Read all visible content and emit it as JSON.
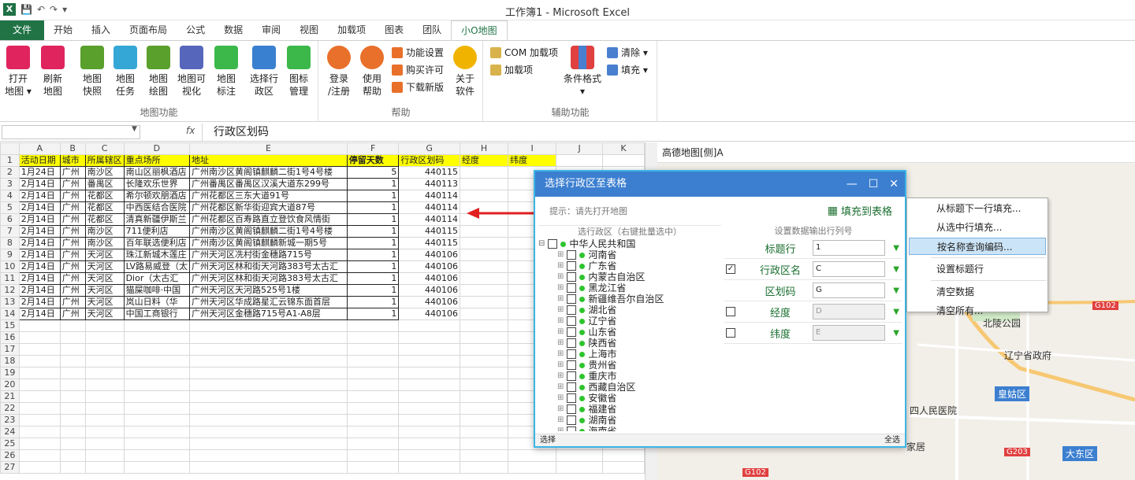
{
  "window": {
    "title": "工作簿1 - Microsoft Excel",
    "logo": "X"
  },
  "tabs": [
    "文件",
    "开始",
    "插入",
    "页面布局",
    "公式",
    "数据",
    "审阅",
    "视图",
    "加载项",
    "图表",
    "团队",
    "小O地图"
  ],
  "ribbon": {
    "map_group": {
      "label": "地图功能",
      "buttons": [
        {
          "label1": "打开",
          "label2": "地图 ▾",
          "color": "#e0245e"
        },
        {
          "label1": "刷新",
          "label2": "地图",
          "color": "#e0245e"
        },
        {
          "label1": "地图",
          "label2": "快照",
          "color": "#5aa02c"
        },
        {
          "label1": "地图",
          "label2": "任务",
          "color": "#35a7d6"
        },
        {
          "label1": "地图",
          "label2": "绘图",
          "color": "#5aa02c"
        },
        {
          "label1": "地图可",
          "label2": "视化",
          "color": "#5566bb"
        },
        {
          "label1": "地图",
          "label2": "标注",
          "color": "#3cb84a"
        },
        {
          "label1": "选择行",
          "label2": "政区",
          "color": "#3a80d0"
        },
        {
          "label1": "图标",
          "label2": "管理",
          "color": "#3cb84a"
        }
      ]
    },
    "help_group": {
      "label": "帮助",
      "buttons": [
        {
          "label1": "登录",
          "label2": "/注册",
          "color": "#e8702a"
        },
        {
          "label1": "使用",
          "label2": "帮助",
          "color": "#e8702a"
        },
        {
          "label1": "关于",
          "label2": "软件",
          "color": "#f0b400"
        }
      ],
      "small": [
        "功能设置",
        "购买许可",
        "下载新版"
      ]
    },
    "aux_group": {
      "label": "辅助功能",
      "small": [
        "COM 加载项",
        "加载项"
      ],
      "cond_label": "条件格式",
      "cond_caret": "▾",
      "right_small": [
        "清除 ▾",
        "填充 ▾"
      ]
    }
  },
  "formula_bar": {
    "name_box": "",
    "fx": "fx",
    "content": "行政区划码"
  },
  "sheet": {
    "columns": [
      "A",
      "B",
      "C",
      "D",
      "E",
      "F",
      "G",
      "H",
      "I",
      "J",
      "K"
    ],
    "header": [
      "活动日期",
      "城市",
      "所属辖区",
      "重点场所",
      "地址",
      "停留天数",
      "行政区划码",
      "经度",
      "纬度",
      "",
      ""
    ],
    "rows": [
      [
        "1月24日",
        "广州",
        "南沙区",
        "南山区丽枫酒店",
        "广州南沙区黄阁镇麒麟二街1号4号楼",
        "5",
        "440115"
      ],
      [
        "2月14日",
        "广州",
        "番禺区",
        "长隆欢乐世界",
        "广州番禺区番禺区汉溪大道东299号",
        "1",
        "440113"
      ],
      [
        "2月14日",
        "广州",
        "花都区",
        "希尔顿欢朋酒店",
        "广州花都区三东大道91号",
        "1",
        "440114"
      ],
      [
        "2月14日",
        "广州",
        "花都区",
        "中西医结合医院",
        "广州花都区新华街迎宾大道87号",
        "1",
        "440114"
      ],
      [
        "2月14日",
        "广州",
        "花都区",
        "清真新疆伊斯兰",
        "广州花都区百寿路直立登饮食风情街",
        "1",
        "440114"
      ],
      [
        "2月14日",
        "广州",
        "南沙区",
        "711便利店",
        "广州南沙区黄阁镇麒麟二街1号4号楼",
        "1",
        "440115"
      ],
      [
        "2月14日",
        "广州",
        "南沙区",
        "百年联选便利店",
        "广州南沙区黄阁镇麒麟新城一期5号",
        "1",
        "440115"
      ],
      [
        "2月14日",
        "广州",
        "天河区",
        "珠江新城木莲庄",
        "广州天河区冼村街金穗路715号",
        "1",
        "440106"
      ],
      [
        "2月14日",
        "广州",
        "天河区",
        "LV路易威登（太",
        "广州天河区林和街天河路383号太古汇",
        "1",
        "440106"
      ],
      [
        "2月14日",
        "广州",
        "天河区",
        "Dior（太古汇",
        "广州天河区林和街天河路383号太古汇",
        "1",
        "440106"
      ],
      [
        "2月14日",
        "广州",
        "天河区",
        "猫屎咖啡·中国",
        "广州天河区天河路525号1楼",
        "1",
        "440106"
      ],
      [
        "2月14日",
        "广州",
        "天河区",
        "岚山日料（华",
        "广州天河区华成路星汇云锦东面首层",
        "1",
        "440106"
      ],
      [
        "2月14日",
        "广州",
        "天河区",
        "中国工商银行",
        "广州天河区金穗路715号A1-A8层",
        "1",
        "440106"
      ]
    ],
    "row_numbers": [
      "1",
      "2",
      "3",
      "4",
      "5",
      "6",
      "7",
      "8",
      "9",
      "10",
      "11",
      "12",
      "13",
      "14",
      "15",
      "16",
      "17",
      "18",
      "19",
      "20",
      "21",
      "22",
      "23",
      "24",
      "25",
      "26",
      "27"
    ]
  },
  "map_pane": {
    "title": "高德地图[侧]A",
    "labels": [
      "北陵公园",
      "辽宁省政府",
      "皇姑区",
      "四人民医院",
      "大东区",
      "G102",
      "G203",
      "G102",
      "家居"
    ]
  },
  "dialog": {
    "title": "选择行政区至表格",
    "hint": "提示：请先打开地图",
    "fill_button": "填充到表格",
    "tree_caption": "选行政区（右键批量选中）",
    "tree_root": "中华人民共和国",
    "provinces": [
      "河南省",
      "广东省",
      "内蒙古自治区",
      "黑龙江省",
      "新疆维吾尔自治区",
      "湖北省",
      "辽宁省",
      "山东省",
      "陕西省",
      "上海市",
      "贵州省",
      "重庆市",
      "西藏自治区",
      "安徽省",
      "福建省",
      "湖南省",
      "海南省"
    ],
    "settings_caption": "设置数据输出行列号",
    "fields": [
      {
        "label": "标题行",
        "value": "1",
        "checked": false,
        "has_checkbox": false,
        "disabled": false
      },
      {
        "label": "行政区名",
        "value": "C",
        "checked": true,
        "has_checkbox": true,
        "disabled": false
      },
      {
        "label": "区划码",
        "value": "G",
        "checked": false,
        "has_checkbox": false,
        "disabled": false
      },
      {
        "label": "经度",
        "value": "D",
        "checked": false,
        "has_checkbox": true,
        "disabled": true
      },
      {
        "label": "纬度",
        "value": "E",
        "checked": false,
        "has_checkbox": true,
        "disabled": true
      }
    ],
    "footer_left": "选择",
    "footer_right": "全选"
  },
  "context_menu": {
    "items": [
      "从标题下一行填充...",
      "从选中行填充...",
      "按名称查询编码...",
      "设置标题行",
      "清空数据",
      "清空所有..."
    ],
    "highlighted_index": 2
  },
  "colors": {
    "excel_green": "#217346",
    "dialog_title": "#3c7fd0",
    "dialog_border": "#3bb5e6",
    "header_yellow": "#ffff00",
    "arrow_red": "#e02020"
  }
}
